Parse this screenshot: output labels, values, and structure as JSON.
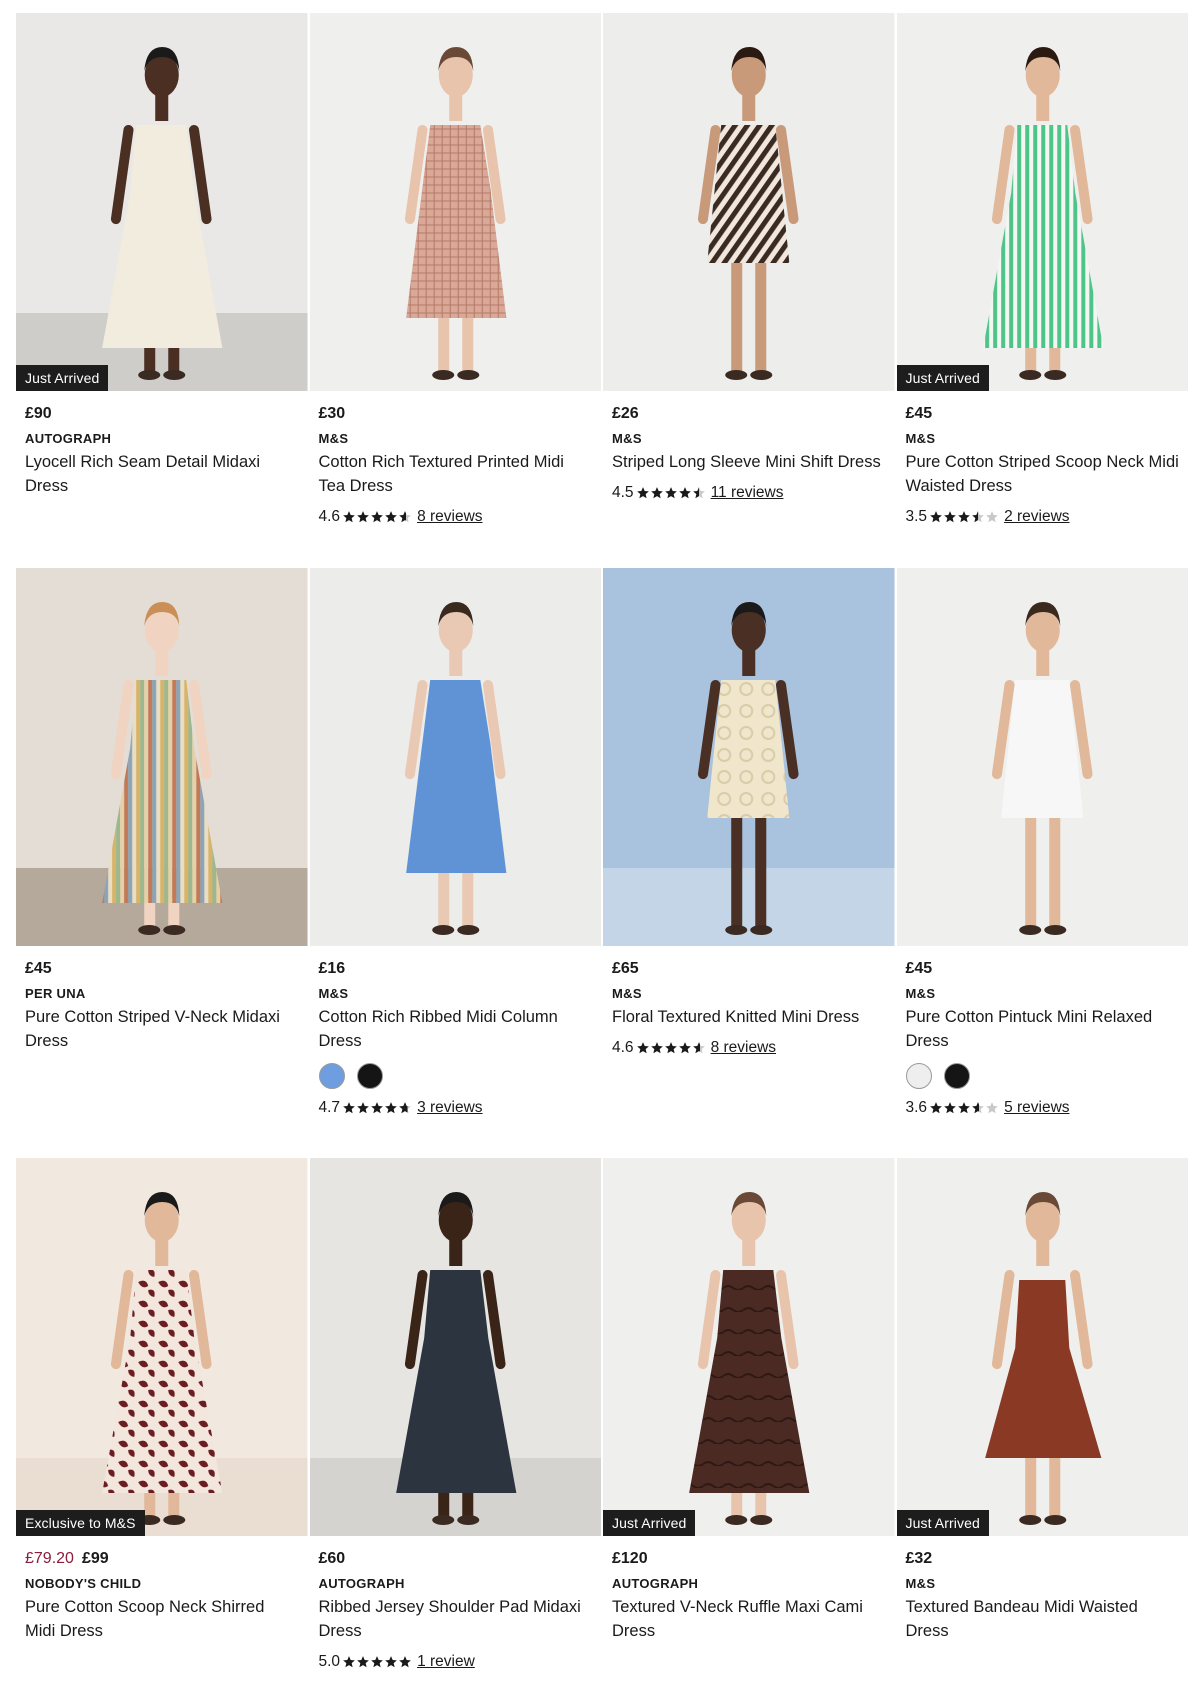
{
  "products": [
    {
      "price": "£90",
      "brand": "AUTOGRAPH",
      "name": "Lyocell Rich Seam Detail Midaxi Dress",
      "badge": "Just Arrived"
    },
    {
      "price": "£30",
      "brand": "M&S",
      "name": "Cotton Rich Textured Printed Midi Tea Dress",
      "rating": "4.6",
      "stars": 4.6,
      "reviews": "8 reviews"
    },
    {
      "price": "£26",
      "brand": "M&S",
      "name": "Striped Long Sleeve Mini Shift Dress",
      "rating": "4.5",
      "stars": 4.5,
      "reviews": "11 reviews"
    },
    {
      "price": "£45",
      "brand": "M&S",
      "name": "Pure Cotton Striped Scoop Neck Midi Waisted Dress",
      "rating": "3.5",
      "stars": 3.5,
      "reviews": "2 reviews",
      "badge": "Just Arrived"
    },
    {
      "price": "£45",
      "brand": "PER UNA",
      "name": "Pure Cotton Striped V-Neck Midaxi Dress"
    },
    {
      "price": "£16",
      "brand": "M&S",
      "name": "Cotton Rich Ribbed Midi Column Dress",
      "rating": "4.7",
      "stars": 4.7,
      "reviews": "3 reviews",
      "swatches": [
        "#6f9ee0",
        "#151515"
      ]
    },
    {
      "price": "£65",
      "brand": "M&S",
      "name": "Floral Textured Knitted Mini Dress",
      "rating": "4.6",
      "stars": 4.6,
      "reviews": "8 reviews"
    },
    {
      "price": "£45",
      "brand": "M&S",
      "name": "Pure Cotton Pintuck Mini Relaxed Dress",
      "rating": "3.6",
      "stars": 3.6,
      "reviews": "5 reviews",
      "swatches": [
        "#eeeeee",
        "#151515"
      ]
    },
    {
      "price": "£99",
      "sale_price": "£79.20",
      "brand": "NOBODY'S CHILD",
      "name": "Pure Cotton Scoop Neck Shirred Midi Dress",
      "badge": "Exclusive to M&S"
    },
    {
      "price": "£60",
      "brand": "AUTOGRAPH",
      "name": "Ribbed Jersey Shoulder Pad Midaxi Dress",
      "rating": "5.0",
      "stars": 5.0,
      "reviews": "1 review"
    },
    {
      "price": "£120",
      "brand": "AUTOGRAPH",
      "name": "Textured V-Neck Ruffle Maxi Cami Dress",
      "badge": "Just Arrived"
    },
    {
      "price": "£32",
      "brand": "M&S",
      "name": "Textured Bandeau Midi Waisted Dress",
      "badge": "Just Arrived"
    }
  ],
  "images": [
    {
      "bg": "#e9e8e6",
      "floor": "#b9b6b2",
      "dress": "#f1ecdd",
      "skin": "#4a2f22",
      "hair": "#1a1a1a",
      "shape": "midaxi",
      "pattern": "none"
    },
    {
      "bg": "#efefee",
      "floor": "#efefee",
      "dress": "#d9a897",
      "skin": "#e8c4ad",
      "hair": "#6a4a36",
      "shape": "midi",
      "pattern": "check"
    },
    {
      "bg": "#ededec",
      "floor": "#ededec",
      "dress": "#3a2a22",
      "skin": "#c99a7a",
      "hair": "#2a1a12",
      "shape": "mini",
      "pattern": "diag"
    },
    {
      "bg": "#efefee",
      "floor": "#efefee",
      "dress": "#4fc48a",
      "skin": "#e2b89a",
      "hair": "#2a1a12",
      "shape": "midaxi",
      "pattern": "vstripe"
    },
    {
      "bg": "#e3ddd6",
      "floor": "#8f7d6b",
      "dress": "#c9ae7e",
      "skin": "#f0d3c0",
      "hair": "#c98f56",
      "shape": "midaxi",
      "pattern": "multistripe"
    },
    {
      "bg": "#ececeb",
      "floor": "#ececeb",
      "dress": "#5f93d6",
      "skin": "#e9c9b4",
      "hair": "#3a2a1e",
      "shape": "midi",
      "pattern": "none"
    },
    {
      "bg": "#a9c2dd",
      "floor": "#dbe6f1",
      "dress": "#efe6cc",
      "skin": "#4a3024",
      "hair": "#1a1a1a",
      "shape": "mini",
      "pattern": "floral"
    },
    {
      "bg": "#efefee",
      "floor": "#efefee",
      "dress": "#f7f7f7",
      "skin": "#e2b89a",
      "hair": "#3a2a1e",
      "shape": "mini",
      "pattern": "none"
    },
    {
      "bg": "#f1e8df",
      "floor": "#e3d4c6",
      "dress": "#6a1e22",
      "skin": "#e2b89a",
      "hair": "#1a1a1a",
      "shape": "midaxi",
      "pattern": "print"
    },
    {
      "bg": "#e7e5e2",
      "floor": "#c7c4bf",
      "dress": "#2c3440",
      "skin": "#3a2418",
      "hair": "#1a1a1a",
      "shape": "midaxi",
      "pattern": "none"
    },
    {
      "bg": "#efefee",
      "floor": "#efefee",
      "dress": "#4a2a22",
      "skin": "#e8c4ad",
      "hair": "#6a4a36",
      "shape": "midaxi",
      "pattern": "ruffle"
    },
    {
      "bg": "#efefee",
      "floor": "#efefee",
      "dress": "#8a3a24",
      "skin": "#e2b89a",
      "hair": "#6a4a36",
      "shape": "bandeau",
      "pattern": "none"
    }
  ]
}
